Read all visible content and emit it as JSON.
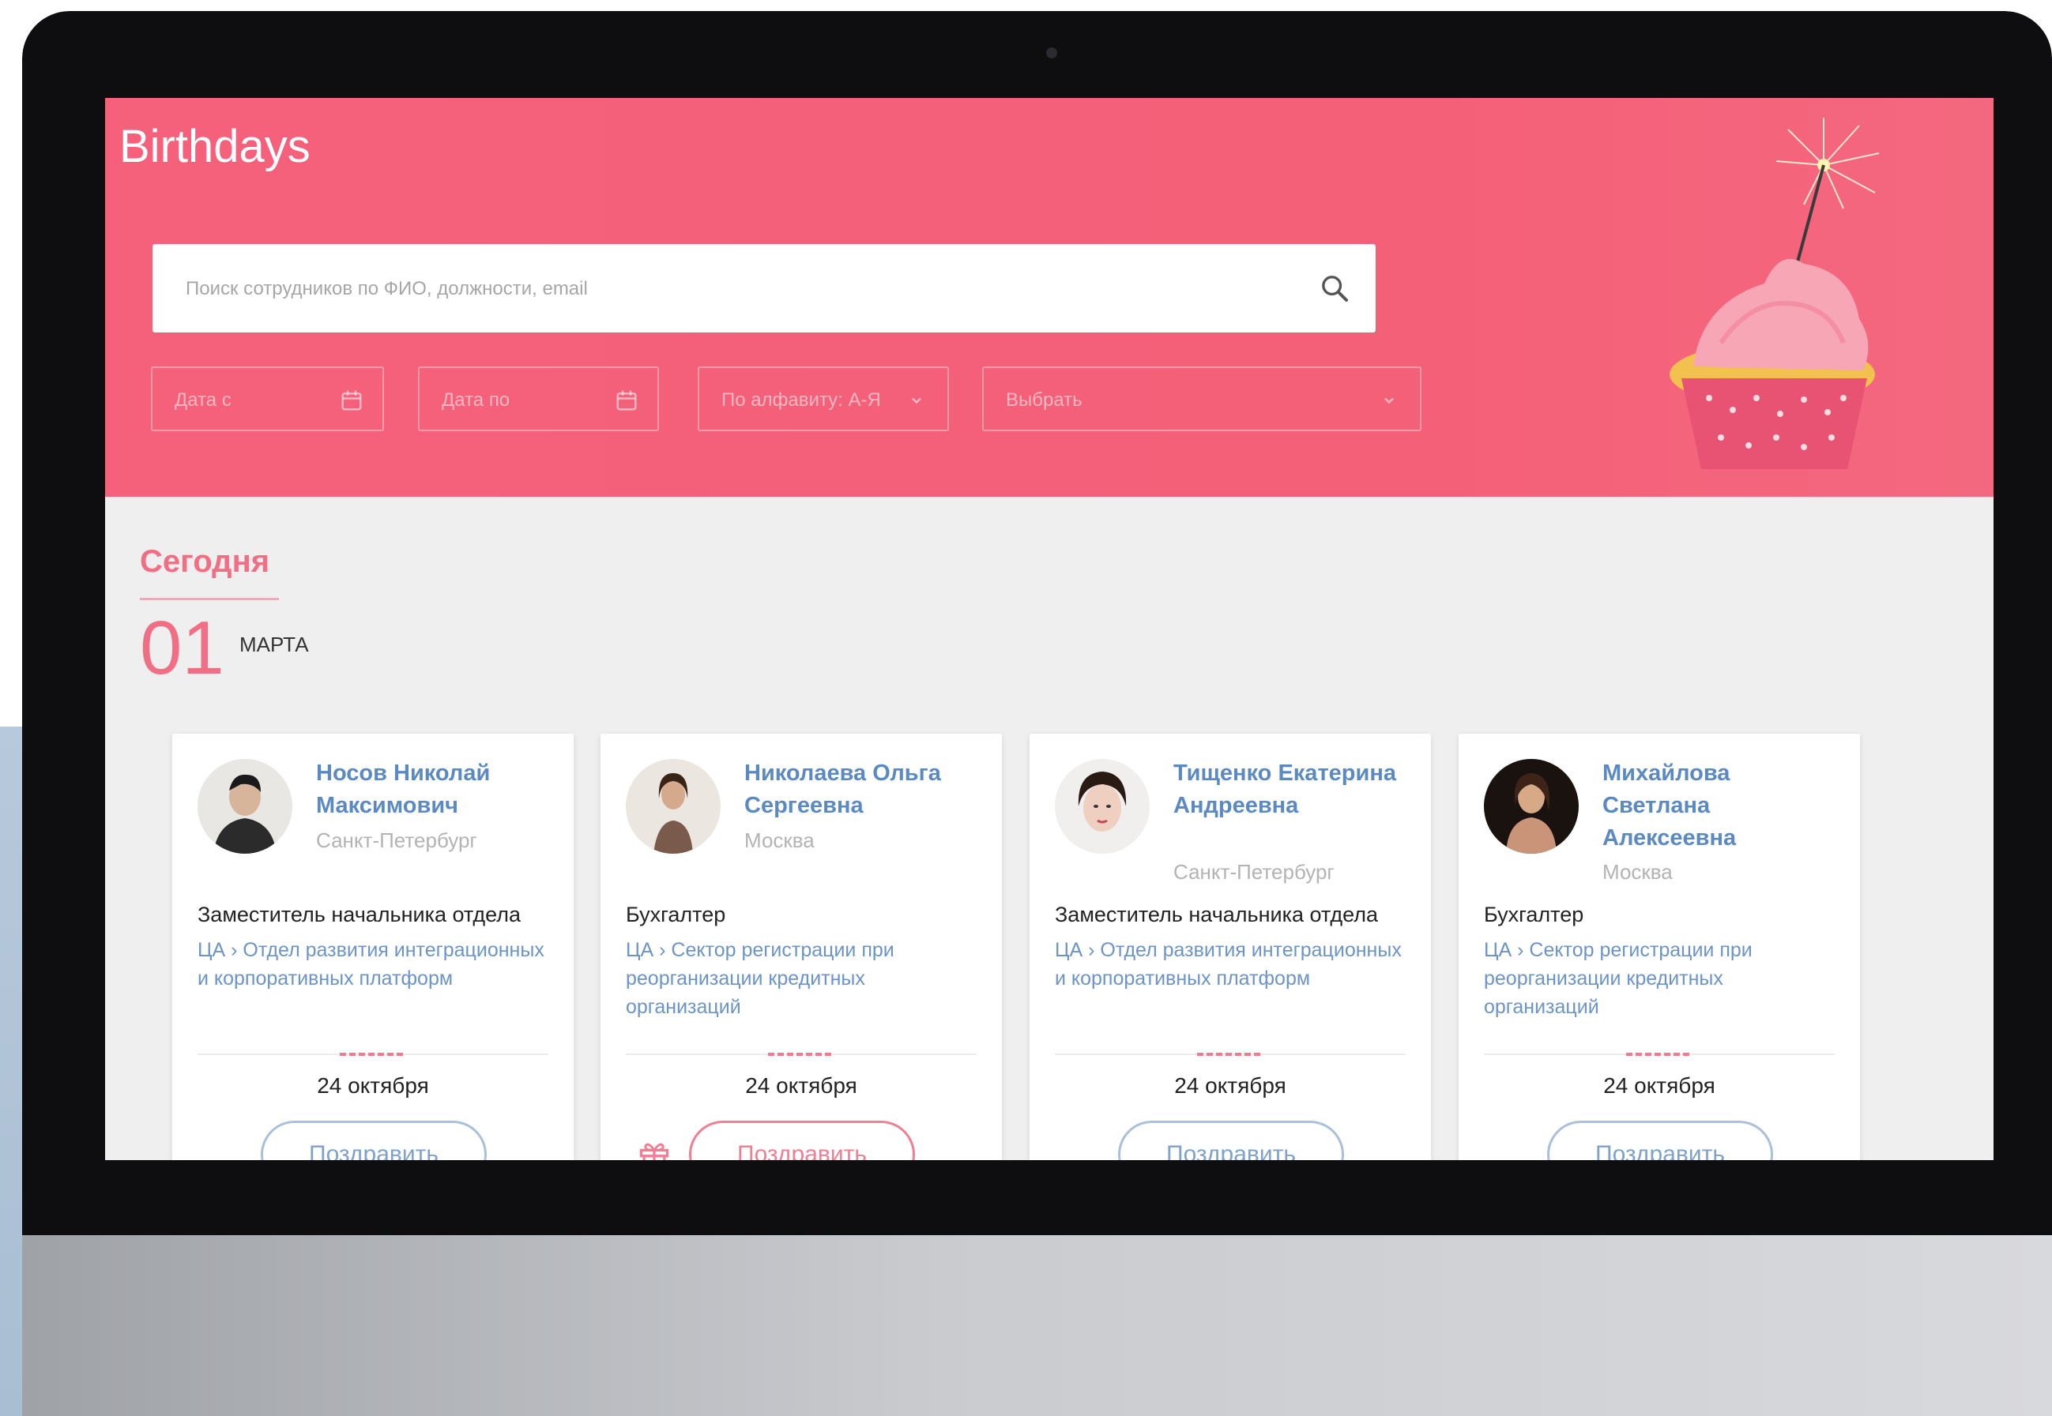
{
  "app": {
    "title": "Birthdays"
  },
  "search": {
    "placeholder": "Поиск сотрудников по ФИО, должности, email"
  },
  "filters": [
    {
      "label": "Дата с",
      "icon": "calendar-icon"
    },
    {
      "label": "Дата по",
      "icon": "calendar-icon"
    },
    {
      "label": "По алфавиту: А-Я",
      "icon": "chevron-down-icon"
    },
    {
      "label": "Выбрать",
      "icon": "chevron-down-icon"
    }
  ],
  "section": {
    "title": "Сегодня",
    "day": "01",
    "month": "МАРТА"
  },
  "cards": [
    {
      "name": "Носов Николай Максимович",
      "city": "Санкт-Петербург",
      "position": "Заместитель начальника отдела",
      "department": "ЦА  ›  Отдел развития интеграционных и корпоративных платформ",
      "date": "24 октября",
      "button": "Поздравить",
      "highlighted": false
    },
    {
      "name": "Николаева Ольга Сергеевна",
      "city": "Москва",
      "position": "Бухгалтер",
      "department": "ЦА  ›  Сектор регистрации при реорганизации кредитных организаций",
      "date": "24 октября",
      "button": "Поздравить",
      "highlighted": true
    },
    {
      "name": "Тищенко Екатерина Андреевна",
      "city": "Санкт-Петербург",
      "position": "Заместитель начальника отдела",
      "department": "ЦА  ›  Отдел развития интеграционных и корпоративных платформ",
      "date": "24 октября",
      "button": "Поздравить",
      "highlighted": false
    },
    {
      "name": "Михайлова Светлана Алексеевна",
      "city": "Москва",
      "position": "Бухгалтер",
      "department": "ЦА  ›  Сектор регистрации при реорганизации кредитных организаций",
      "date": "24 октября",
      "button": "Поздравить",
      "highlighted": false
    }
  ],
  "colors": {
    "accent": "#f5617b",
    "link": "#5b8ac3",
    "background": "#efefef"
  }
}
